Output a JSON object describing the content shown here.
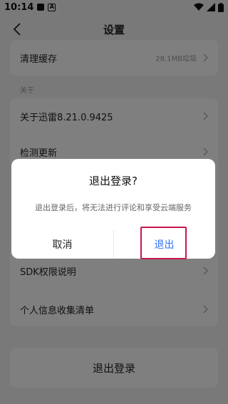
{
  "status_bar": {
    "time": "10:14",
    "badge_letter": "A"
  },
  "header": {
    "title": "设置"
  },
  "settings": {
    "clear_cache": {
      "label": "清理缓存",
      "value": "28.1MB垃圾"
    },
    "about_section": "关于",
    "about_app": "关于迅雷8.21.0.9425",
    "check_update": "检测更新",
    "sdk_permissions": "SDK权限说明",
    "personal_info": "个人信息收集清单"
  },
  "logout_button": "退出登录",
  "dialog": {
    "title": "退出登录?",
    "message": "退出登录后，将无法进行评论和享受云端服务",
    "cancel": "取消",
    "confirm": "退出"
  },
  "colors": {
    "accent": "#2f73f5",
    "highlight": "#c8174a"
  }
}
